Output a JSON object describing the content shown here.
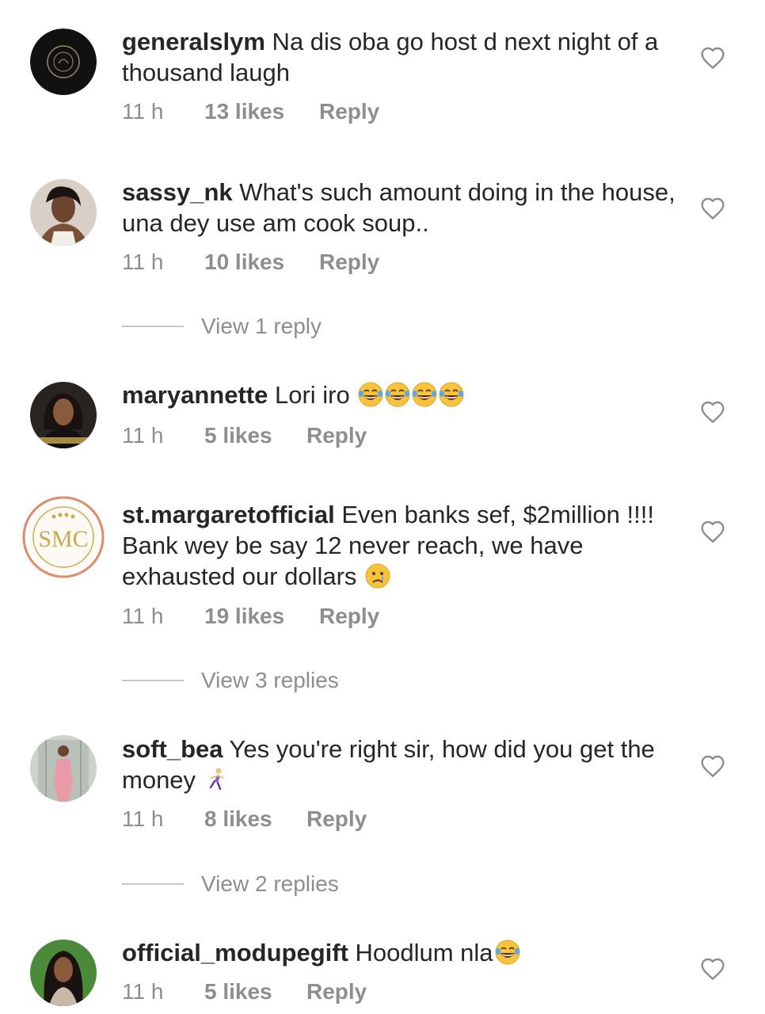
{
  "comments": [
    {
      "username": "generalslym",
      "text": " Na dis oba go host d next night of a thousand laugh",
      "time": "11 h",
      "likes": "13 likes",
      "reply": "Reply",
      "emoji": ""
    },
    {
      "username": "sassy_nk",
      "text": " What's such amount doing in the house, una dey use am cook soup..",
      "time": "11 h",
      "likes": "10 likes",
      "reply": "Reply",
      "emoji": ""
    },
    {
      "username": "maryannette",
      "text": " Lori iro",
      "time": "11 h",
      "likes": "5 likes",
      "reply": "Reply",
      "emoji": "😂😂😂😂"
    },
    {
      "username": "st.margaretofficial",
      "text": " Even banks sef, $2million !!!! Bank wey be say 12 never reach, we have exhausted our dollars ",
      "time": "11 h",
      "likes": "19 likes",
      "reply": "Reply",
      "emoji": "😢"
    },
    {
      "username": "soft_bea",
      "text": " Yes you're right sir,  how did you get the money ",
      "time": "11 h",
      "likes": "8 likes",
      "reply": "Reply",
      "emoji": "🏃‍♀️"
    },
    {
      "username": "official_modupegift",
      "text": " Hoodlum nla",
      "time": "11 h",
      "likes": "5 likes",
      "reply": "Reply",
      "emoji": "😂"
    }
  ],
  "view_replies": [
    {
      "label": "View 1 reply"
    },
    {
      "label": "View 3 replies"
    },
    {
      "label": "View 2 replies"
    }
  ],
  "avatar_monogram": "SMC",
  "colors": {
    "text": "#262626",
    "meta": "#8e8e8e",
    "divider": "#c7c7c7",
    "story_ring": "#e08a6a"
  },
  "icons": [
    "heart-outline-icon",
    "laughing-tears-emoji",
    "crying-emoji",
    "woman-running-emoji"
  ]
}
